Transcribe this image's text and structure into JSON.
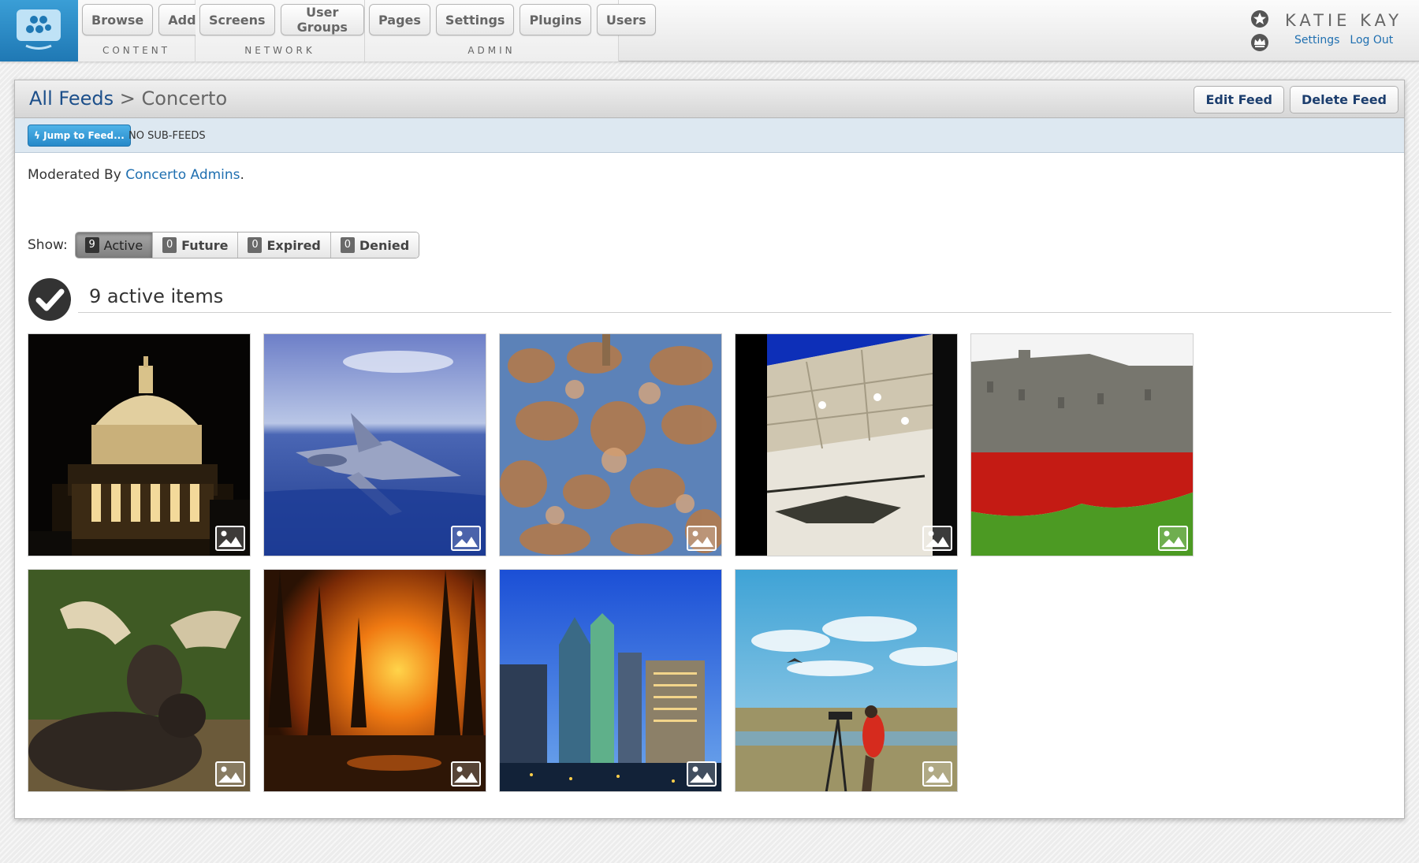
{
  "app": {
    "logo": "concerto-logo-icon"
  },
  "nav": {
    "groups": [
      {
        "label": "CONTENT",
        "buttons": [
          "Browse",
          "Add"
        ]
      },
      {
        "label": "NETWORK",
        "buttons": [
          "Screens",
          "User Groups"
        ]
      },
      {
        "label": "ADMIN",
        "buttons": [
          "Pages",
          "Settings",
          "Plugins",
          "Users"
        ]
      }
    ]
  },
  "user": {
    "name": "KATIE KAY",
    "icons": [
      "star-badge-icon",
      "crown-icon"
    ],
    "links": [
      "Settings",
      "Log Out"
    ]
  },
  "header": {
    "breadcrumb_root": "All Feeds",
    "separator": ">",
    "feed_name": "Concerto",
    "edit_label": "Edit Feed",
    "delete_label": "Delete Feed"
  },
  "subbar": {
    "jump_label": "Jump to Feed...",
    "subfeeds_text": "NO SUB-FEEDS"
  },
  "moderation": {
    "prefix": "Moderated By",
    "group": "Concerto Admins",
    "suffix": "."
  },
  "filter": {
    "label": "Show:",
    "options": [
      {
        "count": "9",
        "label": "Active",
        "selected": true
      },
      {
        "count": "0",
        "label": "Future",
        "selected": false
      },
      {
        "count": "0",
        "label": "Expired",
        "selected": false
      },
      {
        "count": "0",
        "label": "Denied",
        "selected": false
      }
    ]
  },
  "items": {
    "title": "9 active items",
    "tiles": [
      {
        "subject": "capitol dome at night",
        "type_icon": "image-icon"
      },
      {
        "subject": "jet aircraft over ocean",
        "type_icon": "image-icon"
      },
      {
        "subject": "fresco painting",
        "type_icon": "image-icon"
      },
      {
        "subject": "helicopter in hangar",
        "type_icon": "image-icon"
      },
      {
        "subject": "castle with red poppies",
        "type_icon": "image-icon"
      },
      {
        "subject": "moose lying in grass",
        "type_icon": "image-icon"
      },
      {
        "subject": "forest fire",
        "type_icon": "image-icon"
      },
      {
        "subject": "city skyscrapers at dusk",
        "type_icon": "image-icon"
      },
      {
        "subject": "photographer with tripod in field",
        "type_icon": "image-icon"
      }
    ]
  },
  "colors": {
    "brand_blue": "#2a8ccb",
    "link_blue": "#1f6fb0",
    "breadcrumb_blue": "#1c4f8a",
    "subbar_bg": "#dde8f1"
  }
}
